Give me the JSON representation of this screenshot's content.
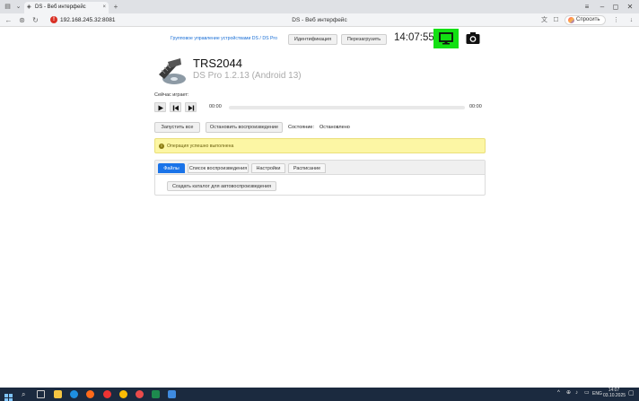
{
  "browser": {
    "tab_title": "DS - Веб интерфейс",
    "tab_close": "×",
    "new_tab": "+",
    "url": "192.168.245.32:8081",
    "page_title": "DS - Веб интерфейс",
    "ask_label": "Спросить",
    "win_min": "–",
    "win_max": "◻",
    "win_close": "✕"
  },
  "header": {
    "group_link": "Групповое управление устройствами DS / DS Pro",
    "identify_label": "Идентификация",
    "reboot_label": "Перезагрузить",
    "clock": "14:07:55",
    "monitor_color": "#13e013"
  },
  "device": {
    "name": "TRS2044",
    "subtitle": "DS Pro 1.2.13 (Android 13)"
  },
  "player": {
    "now_playing_label": "Сейчас играет:",
    "time_start": "00:00",
    "time_end": "00:00",
    "progress": 0
  },
  "actions": {
    "start_all": "Запустить все",
    "stop_playback": "Остановить воспроизведение",
    "state_label": "Состояние:",
    "state_value": "Остановлено"
  },
  "alert": {
    "text": "Операция успешно выполнена"
  },
  "tabs": [
    {
      "label": "Файлы",
      "active": true
    },
    {
      "label": "Список воспроизведения",
      "active": false
    },
    {
      "label": "Настройки",
      "active": false
    },
    {
      "label": "Расписание",
      "active": false
    }
  ],
  "files": {
    "create_dir_label": "Создать каталог для автовоспроизведения"
  },
  "taskbar": {
    "lang": "ENG",
    "time": "14:07",
    "date": "03.10.2025"
  },
  "colors": {
    "accent": "#1a73e8",
    "alert_bg": "#fcf6a4",
    "taskbar": "#1b2a3f"
  }
}
